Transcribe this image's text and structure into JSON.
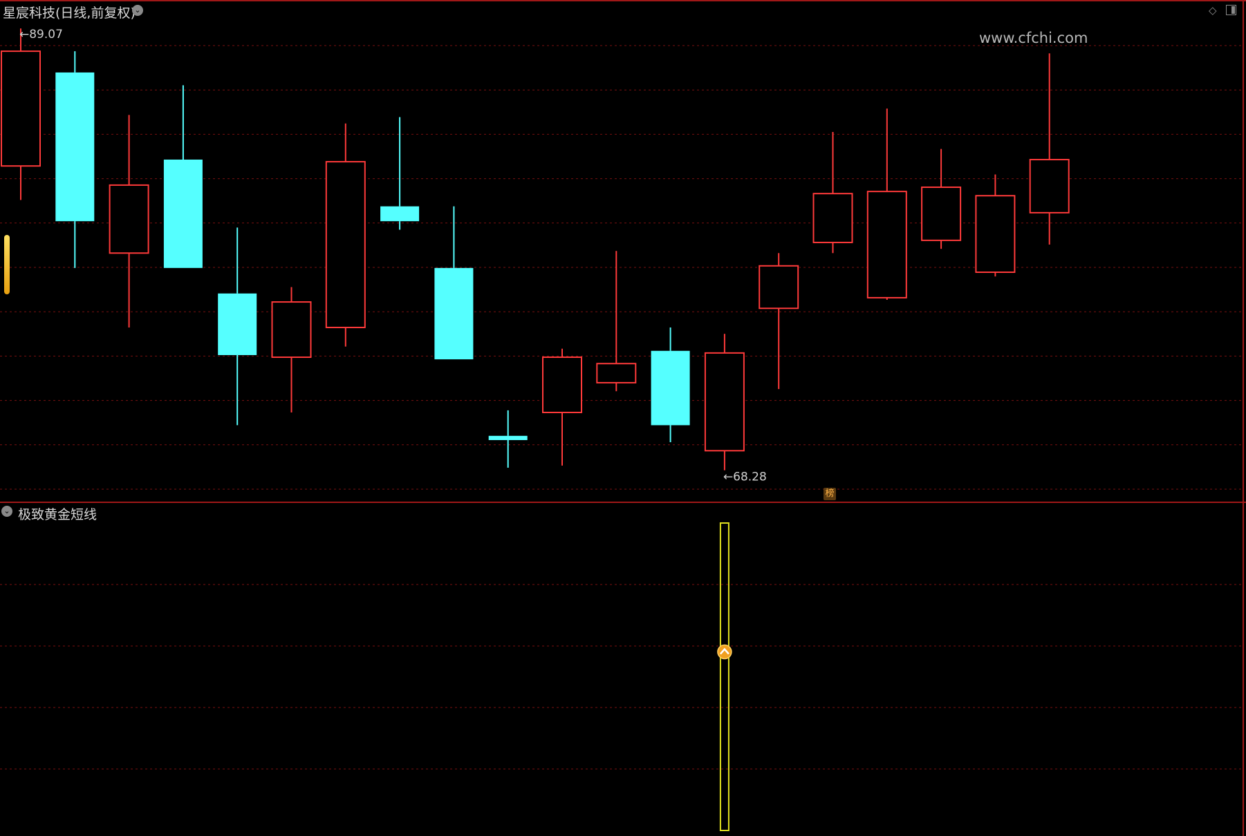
{
  "header": {
    "stock_title": "星宸科技(日线,前复权)",
    "watermark": "www.cfchi.com"
  },
  "indicator": {
    "name": "极致黄金短线",
    "signal_bar_color": "#e0e020",
    "signal_marker": "up-arrow-icon"
  },
  "badge": {
    "label": "榜"
  },
  "colors": {
    "background": "#000000",
    "up_candle": "#ff3a3a",
    "down_candle": "#55ffff",
    "grid": "#7a1010",
    "border": "#a01818"
  },
  "chart_data": [
    {
      "type": "candlestick",
      "title": "星宸科技(日线,前复权)",
      "max_label": "89.07",
      "min_label": "68.28",
      "ylim": [
        67.0,
        89.5
      ],
      "candles": [
        {
          "open": 82.6,
          "close": 88.0,
          "high": 89.07,
          "low": 81.0
        },
        {
          "open": 87.0,
          "close": 80.0,
          "high": 88.0,
          "low": 77.8
        },
        {
          "open": 78.5,
          "close": 81.7,
          "high": 85.0,
          "low": 75.0
        },
        {
          "open": 82.9,
          "close": 77.8,
          "high": 86.4,
          "low": 77.8
        },
        {
          "open": 76.6,
          "close": 73.7,
          "high": 79.7,
          "low": 70.4
        },
        {
          "open": 73.6,
          "close": 76.2,
          "high": 76.9,
          "low": 71.0
        },
        {
          "open": 75.0,
          "close": 82.8,
          "high": 84.6,
          "low": 74.1
        },
        {
          "open": 80.7,
          "close": 80.0,
          "high": 84.9,
          "low": 79.6
        },
        {
          "open": 77.8,
          "close": 73.5,
          "high": 80.7,
          "low": 73.5
        },
        {
          "open": 69.9,
          "close": 69.7,
          "high": 71.1,
          "low": 68.4
        },
        {
          "open": 71.0,
          "close": 73.6,
          "high": 74.0,
          "low": 68.5
        },
        {
          "open": 72.4,
          "close": 73.3,
          "high": 78.6,
          "low": 72.0
        },
        {
          "open": 73.9,
          "close": 70.4,
          "high": 75.0,
          "low": 69.6
        },
        {
          "open": 69.2,
          "close": 73.8,
          "high": 74.7,
          "low": 68.28
        },
        {
          "open": 75.9,
          "close": 77.9,
          "high": 78.5,
          "low": 72.1
        },
        {
          "open": 79.0,
          "close": 81.3,
          "high": 84.2,
          "low": 78.5
        },
        {
          "open": 76.4,
          "close": 81.4,
          "high": 85.3,
          "low": 76.3
        },
        {
          "open": 79.1,
          "close": 81.6,
          "high": 83.4,
          "low": 78.7
        },
        {
          "open": 77.6,
          "close": 81.2,
          "high": 82.2,
          "low": 77.4
        },
        {
          "open": 80.4,
          "close": 82.9,
          "high": 87.9,
          "low": 78.9
        }
      ]
    },
    {
      "type": "bar",
      "title": "极致黄金短线",
      "signal_index": 13,
      "signal_value": 1,
      "ylim": [
        0,
        1
      ]
    }
  ]
}
